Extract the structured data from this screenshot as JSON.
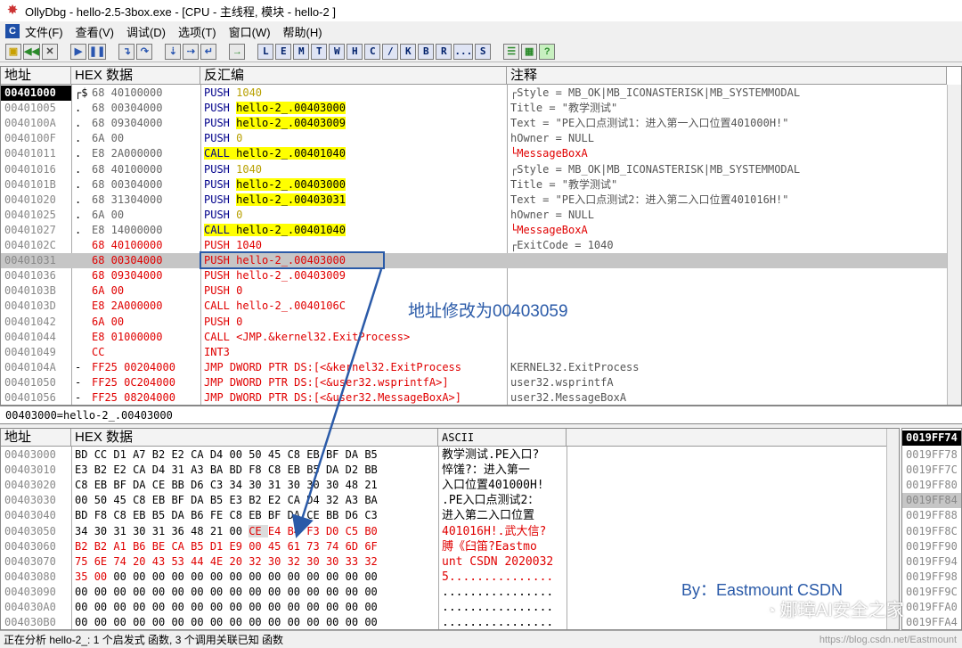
{
  "window": {
    "title": "OllyDbg - hello-2.5-3box.exe - [CPU - 主线程, 模块 - hello-2 ]"
  },
  "menu": [
    "文件(F)",
    "查看(V)",
    "调试(D)",
    "选项(T)",
    "窗口(W)",
    "帮助(H)"
  ],
  "toolbar": {
    "letters": [
      "L",
      "E",
      "M",
      "T",
      "W",
      "H",
      "C",
      "/",
      "K",
      "B",
      "R",
      "...",
      "S"
    ]
  },
  "disasm": {
    "headers": {
      "addr": "地址",
      "hex": "HEX 数据",
      "asm": "反汇编",
      "comment": "注释"
    },
    "rows": [
      {
        "a": "00401000",
        "m": "┌$",
        "h": "68 40100000",
        "i": "PUSH",
        "o": "1040",
        "c": "┌Style = MB_OK|MB_ICONASTERISK|MB_SYSTEMMODAL"
      },
      {
        "a": "00401005",
        "m": ".",
        "h": "68 00304000",
        "i": "PUSH",
        "o": "hello-2_.00403000",
        "c": "Title = \"教学测试\""
      },
      {
        "a": "0040100A",
        "m": ".",
        "h": "68 09304000",
        "i": "PUSH",
        "o": "hello-2_.00403009",
        "c": "Text = \"PE入口点测试1：进入第一入口位置401000H!\""
      },
      {
        "a": "0040100F",
        "m": ".",
        "h": "6A 00",
        "i": "PUSH",
        "o": "0",
        "c": "hOwner = NULL"
      },
      {
        "a": "00401011",
        "m": ".",
        "h": "E8 2A000000",
        "i": "CALL",
        "o": "hello-2_.00401040",
        "c": "└MessageBoxA"
      },
      {
        "a": "00401016",
        "m": ".",
        "h": "68 40100000",
        "i": "PUSH",
        "o": "1040",
        "c": "┌Style = MB_OK|MB_ICONASTERISK|MB_SYSTEMMODAL"
      },
      {
        "a": "0040101B",
        "m": ".",
        "h": "68 00304000",
        "i": "PUSH",
        "o": "hello-2_.00403000",
        "c": "Title = \"教学测试\""
      },
      {
        "a": "00401020",
        "m": ".",
        "h": "68 31304000",
        "i": "PUSH",
        "o": "hello-2_.00403031",
        "c": "Text = \"PE入口点测试2：进入第二入口位置401016H!\""
      },
      {
        "a": "00401025",
        "m": ".",
        "h": "6A 00",
        "i": "PUSH",
        "o": "0",
        "c": "hOwner = NULL"
      },
      {
        "a": "00401027",
        "m": ".",
        "h": "E8 14000000",
        "i": "CALL",
        "o": "hello-2_.00401040",
        "c": "└MessageBoxA"
      },
      {
        "a": "0040102C",
        "m": "",
        "h": "68 40100000",
        "i": "PUSH",
        "o": "1040",
        "c": "┌ExitCode = 1040"
      },
      {
        "a": "00401031",
        "m": "",
        "h": "68 00304000",
        "i": "PUSH",
        "o": "hello-2_.00403000",
        "c": ""
      },
      {
        "a": "00401036",
        "m": "",
        "h": "68 09304000",
        "i": "PUSH",
        "o": "hello-2_.00403009",
        "c": ""
      },
      {
        "a": "0040103B",
        "m": "",
        "h": "6A 00",
        "i": "PUSH",
        "o": "0",
        "c": ""
      },
      {
        "a": "0040103D",
        "m": "",
        "h": "E8 2A000000",
        "i": "CALL",
        "o": "hello-2_.0040106C",
        "c": ""
      },
      {
        "a": "00401042",
        "m": "",
        "h": "6A 00",
        "i": "PUSH",
        "o": "0",
        "c": ""
      },
      {
        "a": "00401044",
        "m": "",
        "h": "E8 01000000",
        "i": "CALL",
        "o": "<JMP.&kernel32.ExitProcess>",
        "c": ""
      },
      {
        "a": "00401049",
        "m": "",
        "h": "CC",
        "i": "INT3",
        "o": "",
        "c": ""
      },
      {
        "a": "0040104A",
        "m": "-",
        "h": "FF25 00204000",
        "i": "JMP",
        "o": "DWORD PTR DS:[<&kernel32.ExitProcess",
        "c": "KERNEL32.ExitProcess"
      },
      {
        "a": "00401050",
        "m": "-",
        "h": "FF25 0C204000",
        "i": "JMP",
        "o": "DWORD PTR DS:[<&user32.wsprintfA>]",
        "c": "user32.wsprintfA"
      },
      {
        "a": "00401056",
        "m": "-",
        "h": "FF25 08204000",
        "i": "JMP",
        "o": "DWORD PTR DS:[<&user32.MessageBoxA>]",
        "c": "user32.MessageBoxA"
      }
    ]
  },
  "info": "00403000=hello-2_.00403000",
  "dump": {
    "headers": {
      "addr": "地址",
      "hex": "HEX 数据",
      "ascii": "ASCII"
    },
    "rows": [
      {
        "a": "00403000",
        "h": "BD CC D1 A7 B2 E2 CA D4 00 50 45 C8 EB BF DA B5",
        "s": "教学测试.PE入口?"
      },
      {
        "a": "00403010",
        "h": "E3 B2 E2 CA D4 31 A3 BA BD F8 C8 EB B5 DA D2 BB",
        "s": "悴馐?：进入第一"
      },
      {
        "a": "00403020",
        "h": "C8 EB BF DA CE BB D6 C3 34 30 31 30 30 30 48 21",
        "s": "入口位置401000H!"
      },
      {
        "a": "00403030",
        "h": "00 50 45 C8 EB BF DA B5 E3 B2 E2 CA D4 32 A3 BA",
        "s": ".PE入口点测试2："
      },
      {
        "a": "00403040",
        "h": "BD F8 C8 EB B5 DA B6 FE C8 EB BF DA CE BB D6 C3",
        "s": "进入第二入口位置"
      },
      {
        "a": "00403050",
        "h": "34 30 31 30 31 36 48 21 00 CE E4 B4 F3 D0 C5 B0",
        "s": "401016H!.武大信?"
      },
      {
        "a": "00403060",
        "h": "B2 B2 A1 B6 BE CA B5 D1 E9 00 45 61 73 74 6D 6F",
        "s": "膊《臼笛?Eastmo"
      },
      {
        "a": "00403070",
        "h": "75 6E 74 20 43 53 44 4E 20 32 30 32 30 30 33 32",
        "s": "unt CSDN 2020032"
      },
      {
        "a": "00403080",
        "h": "35 00 00 00 00 00 00 00 00 00 00 00 00 00 00 00",
        "s": "5..............."
      },
      {
        "a": "00403090",
        "h": "00 00 00 00 00 00 00 00 00 00 00 00 00 00 00 00",
        "s": "................"
      },
      {
        "a": "004030A0",
        "h": "00 00 00 00 00 00 00 00 00 00 00 00 00 00 00 00",
        "s": "................"
      },
      {
        "a": "004030B0",
        "h": "00 00 00 00 00 00 00 00 00 00 00 00 00 00 00 00",
        "s": "................"
      }
    ]
  },
  "stack": {
    "header": "0019FF74",
    "rows": [
      "0019FF78",
      "0019FF7C",
      "0019FF80",
      "0019FF84",
      "0019FF88",
      "0019FF8C",
      "0019FF90",
      "0019FF94",
      "0019FF98",
      "0019FF9C",
      "0019FFA0",
      "0019FFA4"
    ]
  },
  "annotation": "地址修改为00403059",
  "byline": "By：Eastmount CSDN",
  "watermark": "娜璋AI安全之家",
  "url_watermark": "https://blog.csdn.net/Eastmount",
  "status": "正在分析 hello-2_: 1 个启发式 函数, 3 个调用关联已知 函数",
  "colors": {
    "highlight": "#ffff00",
    "modified": "#e00000",
    "selection": "#c6c6c6",
    "annotation": "#2a5aa8"
  }
}
